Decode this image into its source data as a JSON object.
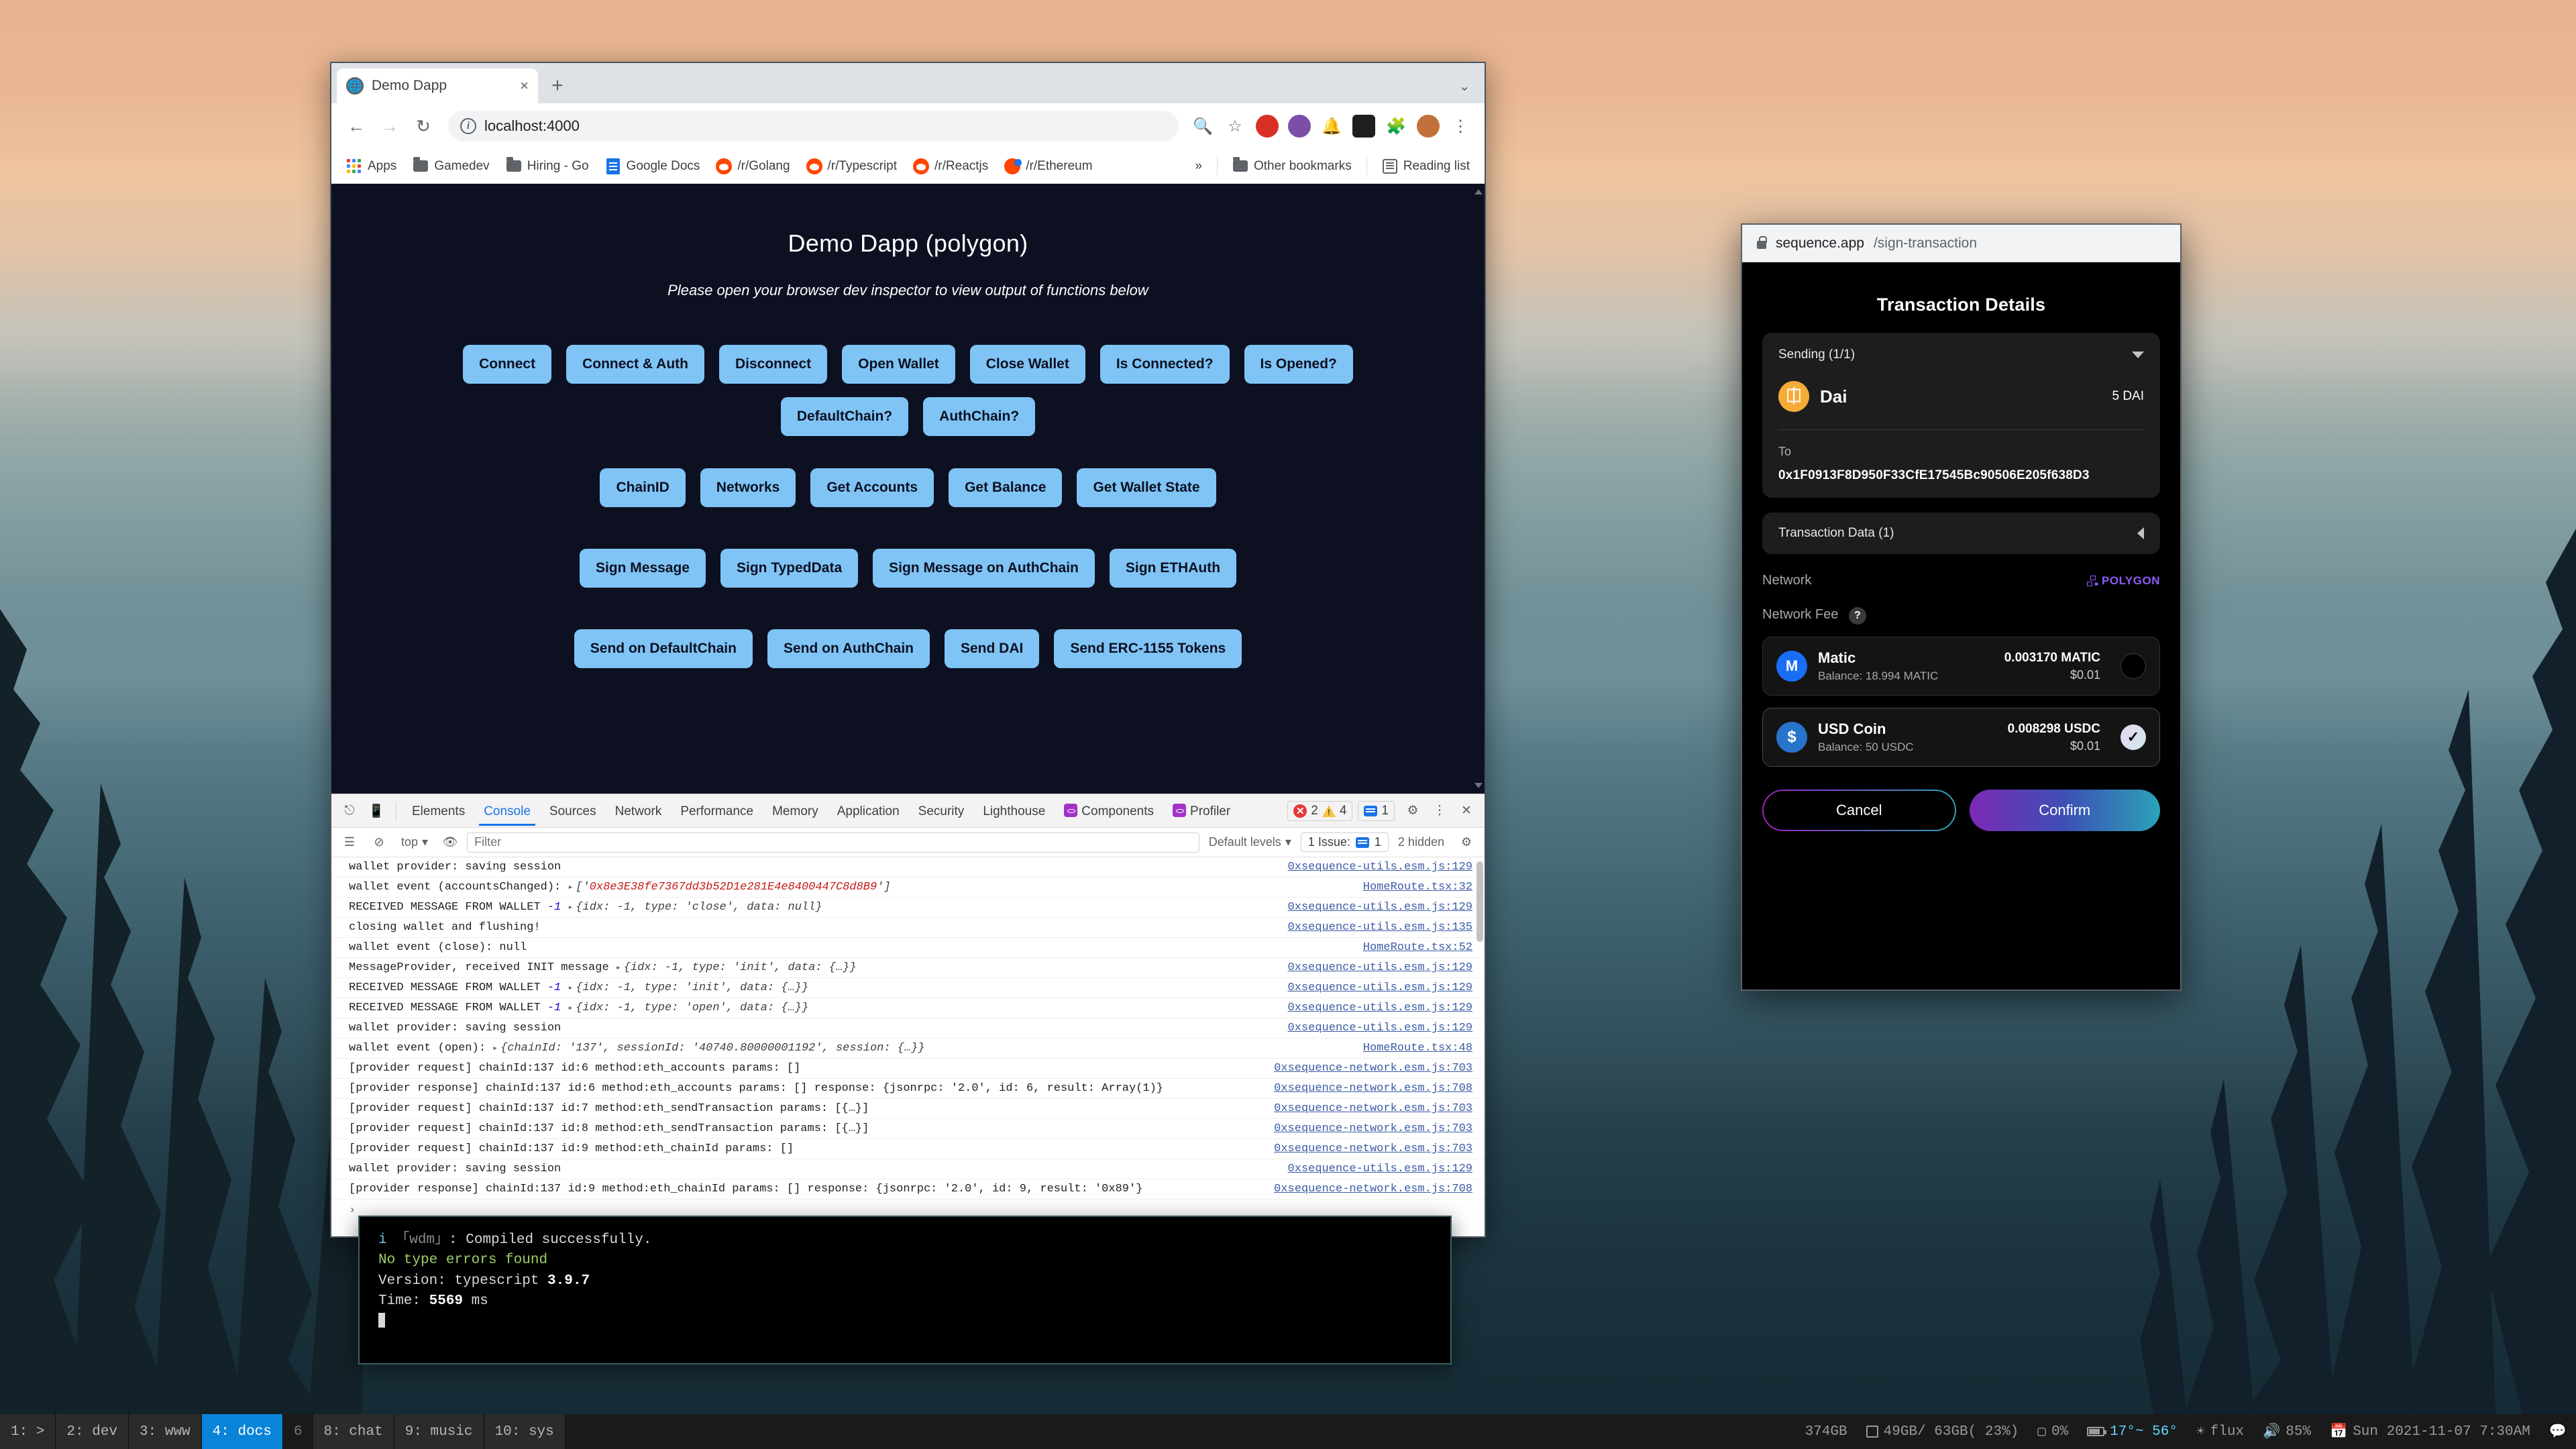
{
  "browser": {
    "tab": {
      "title": "Demo Dapp",
      "favicon": "globe-icon",
      "close": "×"
    },
    "newtab_label": "+",
    "window_caret": "⌄",
    "nav": {
      "back": "←",
      "forward": "→",
      "reload": "↻"
    },
    "omnibox": {
      "value": "localhost:4000",
      "info_icon": "info-icon"
    },
    "toolbar_icons": [
      "zoom-icon",
      "bookmark-star-icon",
      "extension-puzzle-icon",
      "profile-avatar",
      "menu-kebab-icon"
    ],
    "bookmarks": [
      {
        "label": "Apps",
        "icon": "apps-grid-icon"
      },
      {
        "label": "Gamedev",
        "icon": "folder-icon"
      },
      {
        "label": "Hiring - Go",
        "icon": "folder-icon"
      },
      {
        "label": "Google Docs",
        "icon": "google-docs-icon"
      },
      {
        "label": "/r/Golang",
        "icon": "reddit-icon"
      },
      {
        "label": "/r/Typescript",
        "icon": "reddit-icon"
      },
      {
        "label": "/r/Reactjs",
        "icon": "reddit-icon"
      },
      {
        "label": "/r/Ethereum",
        "icon": "reddit-ethereum-icon"
      }
    ],
    "overflow_label": "»",
    "other_bookmarks": "Other bookmarks",
    "reading_list": "Reading list"
  },
  "dapp": {
    "title": "Demo Dapp (polygon)",
    "subtitle": "Please open your browser dev inspector to view output of functions below",
    "rows": [
      [
        "Connect",
        "Connect & Auth",
        "Disconnect",
        "Open Wallet",
        "Close Wallet",
        "Is Connected?",
        "Is Opened?"
      ],
      [
        "DefaultChain?",
        "AuthChain?"
      ],
      [
        "ChainID",
        "Networks",
        "Get Accounts",
        "Get Balance",
        "Get Wallet State"
      ],
      [
        "Sign Message",
        "Sign TypedData",
        "Sign Message on AuthChain",
        "Sign ETHAuth"
      ],
      [
        "Send on DefaultChain",
        "Send on AuthChain",
        "Send DAI",
        "Send ERC-1155 Tokens"
      ]
    ],
    "button_color": "#7fc4f5",
    "background_color": "#0d1021"
  },
  "devtools": {
    "tabs": [
      {
        "label": "Elements",
        "active": false
      },
      {
        "label": "Console",
        "active": true
      },
      {
        "label": "Sources",
        "active": false
      },
      {
        "label": "Network",
        "active": false
      },
      {
        "label": "Performance",
        "active": false
      },
      {
        "label": "Memory",
        "active": false
      },
      {
        "label": "Application",
        "active": false
      },
      {
        "label": "Security",
        "active": false
      },
      {
        "label": "Lighthouse",
        "active": false
      },
      {
        "label": "Components",
        "active": false,
        "icon": "react-icon"
      },
      {
        "label": "Profiler",
        "active": false,
        "icon": "react-icon"
      }
    ],
    "counts": {
      "errors": "2",
      "warnings": "4",
      "messages": "1"
    },
    "settings_icon": "gear-icon",
    "more_icon": "kebab-icon",
    "close_icon": "close-icon",
    "filterbar": {
      "context": "top",
      "filter_placeholder": "Filter",
      "levels": "Default levels",
      "issues": "1 Issue:",
      "issues_count": "1",
      "hidden": "2 hidden"
    },
    "logs": [
      {
        "text": "wallet provider: saving session",
        "src": "0xsequence-utils.esm.js:129"
      },
      {
        "text": "wallet event (accountsChanged):",
        "expand": true,
        "extra_open": "['",
        "extra_str": "0x8e3E38fe7367dd3b52D1e281E4e8400447C8d8B9",
        "extra_close": "']",
        "src": "HomeRoute.tsx:32"
      },
      {
        "text": "RECEIVED MESSAGE FROM WALLET",
        "num": "-1",
        "obj": "{idx: -1, type: 'close', data: null}",
        "src": "0xsequence-utils.esm.js:129"
      },
      {
        "text": "closing wallet and flushing!",
        "src": "0xsequence-utils.esm.js:135"
      },
      {
        "text": "wallet event (close): null",
        "src": "HomeRoute.tsx:52"
      },
      {
        "text": "MessageProvider, received INIT message",
        "obj": "{idx: -1, type: 'init', data: {…}}",
        "src": "0xsequence-utils.esm.js:129"
      },
      {
        "text": "RECEIVED MESSAGE FROM WALLET",
        "num": "-1",
        "obj": "{idx: -1, type: 'init', data: {…}}",
        "src": "0xsequence-utils.esm.js:129"
      },
      {
        "text": "RECEIVED MESSAGE FROM WALLET",
        "num": "-1",
        "obj": "{idx: -1, type: 'open', data: {…}}",
        "src": "0xsequence-utils.esm.js:129"
      },
      {
        "text": "wallet provider: saving session",
        "src": "0xsequence-utils.esm.js:129"
      },
      {
        "text": "wallet event (open):",
        "obj": "{chainId: '137', sessionId: '40740.80000001192', session: {…}}",
        "src": "HomeRoute.tsx:48"
      },
      {
        "text": "[provider request] chainId:137 id:6 method:eth_accounts params: []",
        "src": "0xsequence-network.esm.js:703"
      },
      {
        "text": "[provider response] chainId:137 id:6 method:eth_accounts params: [] response: {jsonrpc: '2.0', id: 6, result: Array(1)}",
        "src": "0xsequence-network.esm.js:708"
      },
      {
        "text": "[provider request] chainId:137 id:7 method:eth_sendTransaction params: [{…}]",
        "src": "0xsequence-network.esm.js:703"
      },
      {
        "text": "[provider request] chainId:137 id:8 method:eth_sendTransaction params: [{…}]",
        "src": "0xsequence-network.esm.js:703"
      },
      {
        "text": "[provider request] chainId:137 id:9 method:eth_chainId params: []",
        "src": "0xsequence-network.esm.js:703"
      },
      {
        "text": "wallet provider: saving session",
        "src": "0xsequence-utils.esm.js:129"
      },
      {
        "text": "[provider response] chainId:137 id:9 method:eth_chainId params: [] response: {jsonrpc: '2.0', id: 9, result: '0x89'}",
        "src": "0xsequence-network.esm.js:708"
      }
    ],
    "prompt": "›"
  },
  "wallet": {
    "url_domain": "sequence.app",
    "url_path": "/sign-transaction",
    "lock_icon": "lock-icon",
    "title": "Transaction Details",
    "sending": {
      "label": "Sending (1/1)",
      "caret": "chevron-down-icon"
    },
    "token": {
      "name": "Dai",
      "symbol_icon": "dai-icon",
      "amount": "5 DAI"
    },
    "to_label": "To",
    "to_address": "0x1F0913F8D950F33CfE17545Bc90506E205f638D3",
    "transaction_data": {
      "label": "Transaction Data (1)",
      "caret": "chevron-left-icon"
    },
    "network_label": "Network",
    "network_value": "POLYGON",
    "network_fee_label": "Network Fee",
    "help_icon": "question-mark-icon",
    "fee_options": [
      {
        "name": "Matic",
        "balance": "Balance: 18.994 MATIC",
        "amount": "0.003170 MATIC",
        "usd": "$0.01",
        "selected": false,
        "icon": "matic-icon"
      },
      {
        "name": "USD Coin",
        "balance": "Balance: 50 USDC",
        "amount": "0.008298 USDC",
        "usd": "$0.01",
        "selected": true,
        "icon": "usdc-icon"
      }
    ],
    "cancel_label": "Cancel",
    "confirm_label": "Confirm",
    "accent_purple": "#8b5cf6"
  },
  "terminal": {
    "lines": [
      {
        "prefix": "i",
        "bracket": "「wdm」",
        "text": ": Compiled successfully."
      },
      {
        "text": "No type errors found",
        "style": "green"
      },
      {
        "text": "Version: typescript ",
        "bold": "3.9.7"
      },
      {
        "text": "Time: ",
        "bold": "5569",
        "suffix": " ms"
      }
    ]
  },
  "statusbar": {
    "workspaces": [
      {
        "label": "1: >",
        "active": false
      },
      {
        "label": "2: dev",
        "active": false
      },
      {
        "label": "3: www",
        "active": false
      },
      {
        "label": "4: docs",
        "active": true
      },
      {
        "label": "6",
        "active": false,
        "plain": true
      },
      {
        "label": "8: chat",
        "active": false
      },
      {
        "label": "9: music",
        "active": false
      },
      {
        "label": "10: sys",
        "active": false
      }
    ],
    "right": {
      "disk": "374GB",
      "memory": "49GB/ 63GB( 23%)",
      "cpu": "0%",
      "temp": "17°~ 56°",
      "audio_name": "flux",
      "volume": "85%",
      "clock": "Sun 2021-11-07  7:30AM"
    }
  }
}
